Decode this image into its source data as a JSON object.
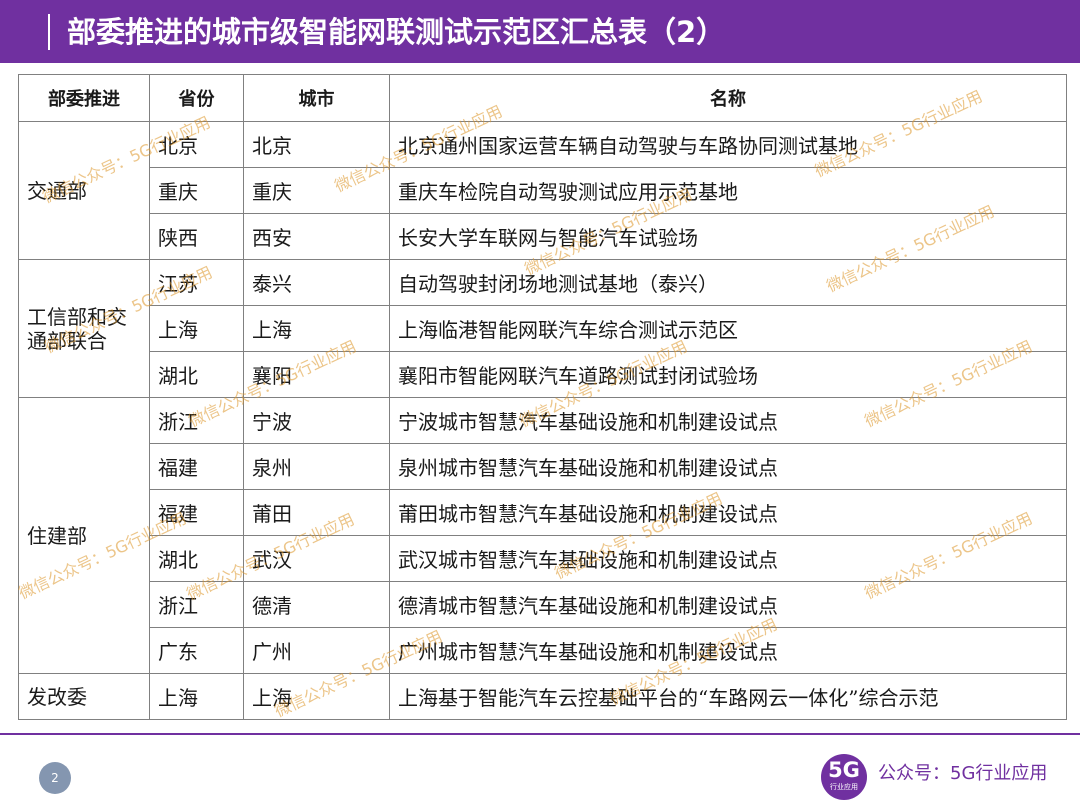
{
  "header": {
    "title": "部委推进的城市级智能网联测试示范区汇总表（2）"
  },
  "table": {
    "columns": [
      "部委推进",
      "省份",
      "城市",
      "名称"
    ],
    "groups": [
      {
        "ministry": "交通部",
        "rows": [
          {
            "province": "北京",
            "city": "北京",
            "name": "北京通州国家运营车辆自动驾驶与车路协同测试基地"
          },
          {
            "province": "重庆",
            "city": "重庆",
            "name": "重庆车检院自动驾驶测试应用示范基地"
          },
          {
            "province": "陕西",
            "city": "西安",
            "name": "长安大学车联网与智能汽车试验场"
          }
        ]
      },
      {
        "ministry": "工信部和交通部联合",
        "rows": [
          {
            "province": "江苏",
            "city": "泰兴",
            "name": "自动驾驶封闭场地测试基地（泰兴）"
          },
          {
            "province": "上海",
            "city": "上海",
            "name": "上海临港智能网联汽车综合测试示范区"
          },
          {
            "province": "湖北",
            "city": "襄阳",
            "name": "襄阳市智能网联汽车道路测试封闭试验场"
          }
        ]
      },
      {
        "ministry": "住建部",
        "rows": [
          {
            "province": "浙江",
            "city": "宁波",
            "name": "宁波城市智慧汽车基础设施和机制建设试点"
          },
          {
            "province": "福建",
            "city": "泉州",
            "name": "泉州城市智慧汽车基础设施和机制建设试点"
          },
          {
            "province": "福建",
            "city": "莆田",
            "name": "莆田城市智慧汽车基础设施和机制建设试点"
          },
          {
            "province": "湖北",
            "city": "武汉",
            "name": "武汉城市智慧汽车基础设施和机制建设试点"
          },
          {
            "province": "浙江",
            "city": "德清",
            "name": "德清城市智慧汽车基础设施和机制建设试点"
          },
          {
            "province": "广东",
            "city": "广州",
            "name": "广州城市智慧汽车基础设施和机制建设试点"
          }
        ]
      },
      {
        "ministry": "发改委",
        "rows": [
          {
            "province": "上海",
            "city": "上海",
            "name": "上海基于智能汽车云控基础平台的“车路网云一体化”综合示范"
          }
        ]
      }
    ]
  },
  "watermark": {
    "text": "微信公众号：5G行业应用"
  },
  "footer": {
    "page_number": "2",
    "logo_big": "5G",
    "logo_small": "行业应用",
    "account": "公众号：5G行业应用"
  },
  "colors": {
    "accent": "#7030a0",
    "page_badge": "#8496b0",
    "watermark": "#dc9628"
  }
}
